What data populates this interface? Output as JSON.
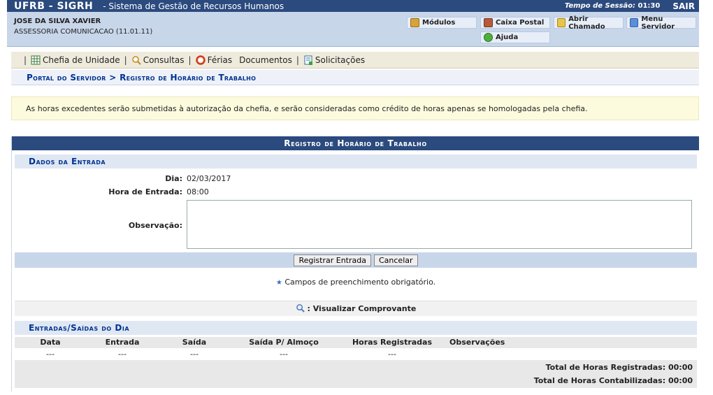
{
  "header": {
    "system_code": "UFRB - SIGRH",
    "system_name": "- Sistema de Gestão de Recursos Humanos",
    "session_label": "Tempo de Sessão:",
    "session_time": "01:30",
    "logout_label": "SAIR"
  },
  "user": {
    "name": "JOSE DA SILVA XAVIER",
    "department": "ASSESSORIA COMUNICACAO (11.01.11)"
  },
  "quick_links": {
    "modulos": "Módulos",
    "caixa_postal": "Caixa Postal",
    "abrir_chamado": "Abrir Chamado",
    "menu_servidor": "Menu Servidor",
    "ajuda": "Ajuda"
  },
  "menu": {
    "chefia": "Chefia de Unidade",
    "consultas": "Consultas",
    "ferias": "Férias",
    "documentos": "Documentos",
    "solicitacoes": "Solicitações"
  },
  "breadcrumb": "Portal do Servidor > Registro de Horário de Trabalho",
  "notice": "As horas excedentes serão submetidas à autorização da chefia, e serão consideradas como crédito de horas apenas se homologadas pela chefia.",
  "form": {
    "title": "Registro de Horário de Trabalho",
    "section_entry": "Dados da Entrada",
    "dia_label": "Dia:",
    "dia_value": "02/03/2017",
    "hora_label": "Hora de Entrada:",
    "hora_value": "08:00",
    "obs_label": "Observação:",
    "obs_value": "",
    "submit_label": "Registrar Entrada",
    "cancel_label": "Cancelar",
    "required_note": "Campos de preenchimento obrigatório.",
    "view_receipt": ": Visualizar Comprovante"
  },
  "entries": {
    "section_title": "Entradas/Saídas do Dia",
    "columns": [
      "Data",
      "Entrada",
      "Saída",
      "Saída P/ Almoço",
      "Horas Registradas",
      "Observações"
    ],
    "rows": [
      [
        "---",
        "---",
        "---",
        "---",
        "---",
        ""
      ]
    ],
    "total_registradas_label": "Total de Horas Registradas:",
    "total_registradas_value": "00:00",
    "total_contabilizadas_label": "Total de Horas Contabilizadas:",
    "total_contabilizadas_value": "00:00"
  },
  "colors": {
    "header_blue": "#2b4a7e",
    "link_blue": "#003390",
    "notice_bg": "#fcfbde"
  }
}
